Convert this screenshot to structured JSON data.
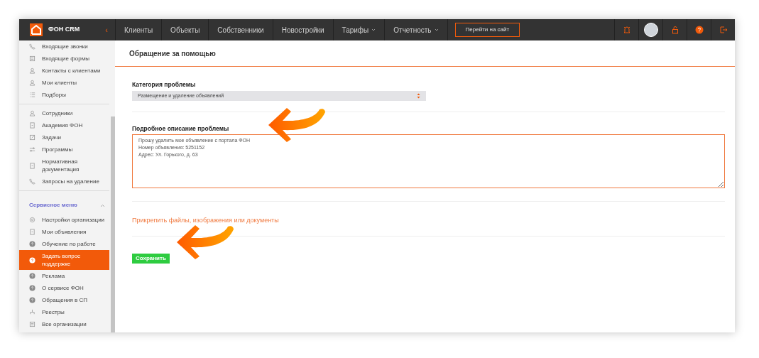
{
  "brand": {
    "name": "ФОН CRM",
    "collapse": "‹"
  },
  "nav": [
    {
      "label": "Клиенты",
      "dropdown": false
    },
    {
      "label": "Объекты",
      "dropdown": false
    },
    {
      "label": "Собственники",
      "dropdown": false
    },
    {
      "label": "Новостройки",
      "dropdown": false
    },
    {
      "label": "Тарифы",
      "dropdown": true
    },
    {
      "label": "Отчетность",
      "dropdown": true
    }
  ],
  "site_button": "Перейти на сайт",
  "sidebar": {
    "groups": [
      {
        "items": [
          {
            "label": "Входящие звонки",
            "selected": false
          },
          {
            "label": "Входящие формы",
            "selected": false
          },
          {
            "label": "Контакты с клиентами",
            "selected": false
          },
          {
            "label": "Мои клиенты",
            "selected": false
          },
          {
            "label": "Подборы",
            "selected": false
          }
        ]
      },
      {
        "items": [
          {
            "label": "Сотрудники",
            "selected": false
          },
          {
            "label": "Академия ФОН",
            "selected": false
          },
          {
            "label": "Задачи",
            "selected": false
          },
          {
            "label": "Программы",
            "selected": false
          },
          {
            "label": "Нормативная документация",
            "selected": false
          },
          {
            "label": "Запросы на удаление",
            "selected": false
          }
        ]
      },
      {
        "title": "Сервисное меню",
        "expanded": true,
        "items": [
          {
            "label": "Настройки организации",
            "selected": false
          },
          {
            "label": "Мои объявления",
            "selected": false
          },
          {
            "label": "Обучение по работе",
            "selected": false
          },
          {
            "label": "Задать вопрос поддержке",
            "selected": true
          },
          {
            "label": "Реклама",
            "selected": false
          },
          {
            "label": "О сервисе ФОН",
            "selected": false
          },
          {
            "label": "Обращения в СП",
            "selected": false
          },
          {
            "label": "Реестры",
            "selected": false
          },
          {
            "label": "Все организации",
            "selected": false
          }
        ]
      }
    ]
  },
  "page": {
    "title": "Обращение за помощью",
    "category": {
      "label": "Категория проблемы",
      "value": "Размещение и удаление объявлений"
    },
    "description": {
      "label": "Подробное описание проблемы",
      "value": "Прошу удалить мое объявление с портала ФОН\nНомер объявления: 5251152\nАдрес: Ул. Горького, д. 63"
    },
    "attach_link": "Прикрепить файлы, изображения или документы",
    "save_button": "Сохранить"
  }
}
